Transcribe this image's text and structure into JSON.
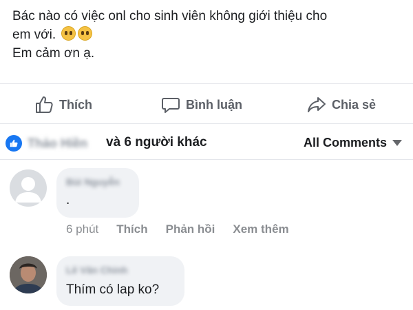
{
  "post": {
    "line1": "Bác nào có việc onl cho sinh viên không giới thiệu cho",
    "line2": "em với.",
    "line3": "Em cảm ơn ạ.",
    "emoji_icons": [
      "pleading-face-icon",
      "pleading-face-icon"
    ]
  },
  "actions": {
    "like_label": "Thích",
    "comment_label": "Bình luận",
    "share_label": "Chia sẻ"
  },
  "reactions": {
    "blurred_name": "Thảo Hiền",
    "others_label": "và 6 người khác",
    "filter_label": "All Comments",
    "badge_color": "#1877f2"
  },
  "comments": [
    {
      "author": "Bùi Nguyễn",
      "text": ".",
      "time": "6 phút",
      "like_label": "Thích",
      "reply_label": "Phản hồi",
      "more_label": "Xem thêm",
      "avatar": "default-avatar"
    },
    {
      "author": "Lê Văn Chinh",
      "text": "Thím có lap ko?",
      "avatar": "photo-avatar"
    }
  ]
}
